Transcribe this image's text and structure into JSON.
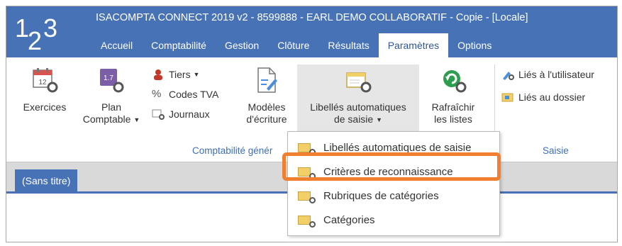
{
  "logo": {
    "d1": "1",
    "d2": "2",
    "d3": "3"
  },
  "app_title": "ISACOMPTA CONNECT 2019 v2 - 8599888 - EARL DEMO COLLABORATIF - Copie - [Locale]",
  "menu": [
    "Accueil",
    "Comptabilité",
    "Gestion",
    "Clôture",
    "Résultats",
    "Paramètres",
    "Options"
  ],
  "ribbon": {
    "exercices": "Exercices",
    "exercices_icon_text": "12",
    "plan_l1": "Plan",
    "plan_l2": "Comptable",
    "plan_icon_text": "1.7",
    "tiers": "Tiers",
    "codes_tva": "Codes TVA",
    "journaux": "Journaux",
    "modeles_l1": "Modèles",
    "modeles_l2": "d'écriture",
    "libelles_l1": "Libellés automatiques",
    "libelles_l2": "de saisie",
    "rafraichir_l1": "Rafraîchir",
    "rafraichir_l2": "les listes",
    "lies_utilisateur": "Liés à l'utilisateur",
    "lies_dossier": "Liés au dossier",
    "group_compta": "Comptabilité génér",
    "group_saisie": "Saisie"
  },
  "doc_tab": "(Sans titre)",
  "dropdown": [
    "Libellés automatiques de saisie",
    "Critères de reconnaissance",
    "Rubriques de catégories",
    "Catégories"
  ],
  "colors": {
    "accent": "#4773b6",
    "highlight": "#f07f2f",
    "group_label": "#3f6fb7"
  }
}
